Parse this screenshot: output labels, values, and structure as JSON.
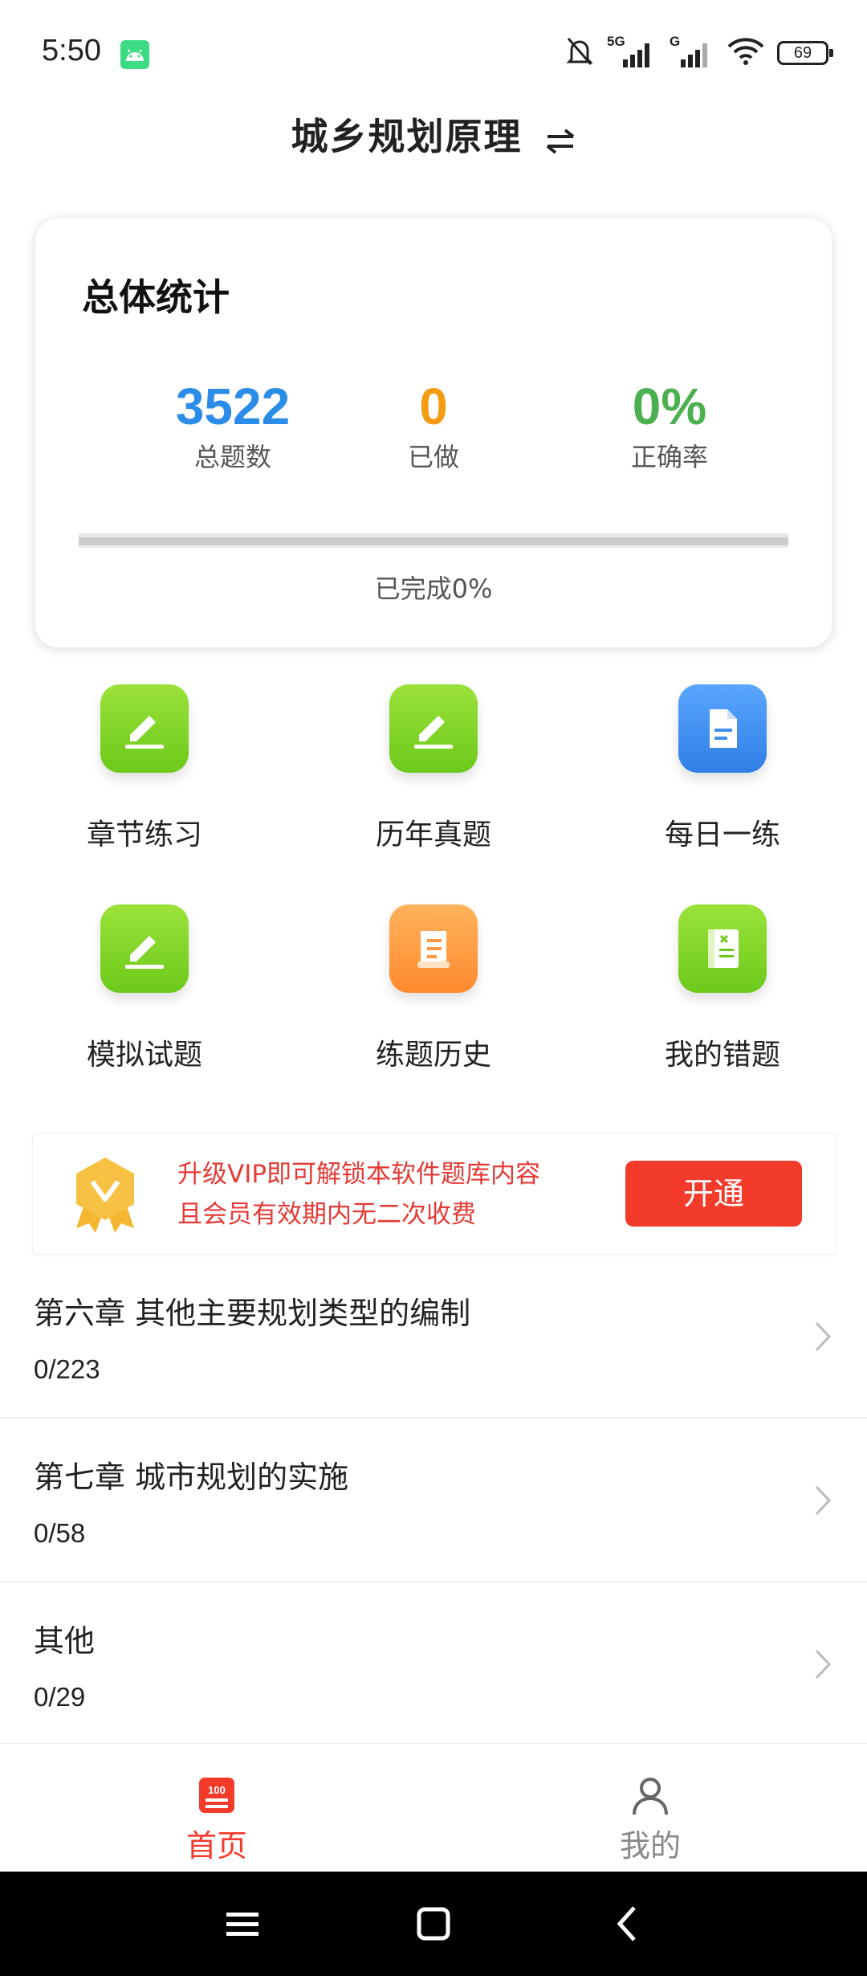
{
  "status_bar": {
    "time": "5:50",
    "network_1": "5G",
    "network_2": "G",
    "battery": "69"
  },
  "header": {
    "title": "城乡规划原理",
    "swap_icon": "swap-arrows-icon"
  },
  "stats": {
    "title": "总体统计",
    "total": {
      "value": "3522",
      "label": "总题数",
      "color": "#2b8de8"
    },
    "done": {
      "value": "0",
      "label": "已做",
      "color": "#f39c12"
    },
    "accuracy": {
      "value": "0%",
      "label": "正确率",
      "color": "#4caf50"
    },
    "progress_fraction": 0,
    "progress_text": "已完成0%"
  },
  "menu": [
    {
      "label": "章节练习",
      "icon": "pencil-icon",
      "color": "#7ed321"
    },
    {
      "label": "历年真题",
      "icon": "pencil-icon",
      "color": "#7ed321"
    },
    {
      "label": "每日一练",
      "icon": "document-icon",
      "color": "#3f8ef0"
    },
    {
      "label": "模拟试题",
      "icon": "pencil-icon",
      "color": "#7ed321"
    },
    {
      "label": "练题历史",
      "icon": "scroll-icon",
      "color": "#ff9640"
    },
    {
      "label": "我的错题",
      "icon": "notebook-x-icon",
      "color": "#7ed321"
    }
  ],
  "vip": {
    "line1": "升级VIP即可解锁本软件题库内容",
    "line2": "且会员有效期内无二次收费",
    "button": "开通",
    "badge_icon": "vip-badge-icon"
  },
  "chapters": [
    {
      "title": "第六章 其他主要规划类型的编制",
      "count": "0/223"
    },
    {
      "title": "第七章 城市规划的实施",
      "count": "0/58"
    },
    {
      "title": "其他",
      "count": "0/29"
    }
  ],
  "tabs": [
    {
      "label": "首页",
      "icon": "home-100-icon",
      "active": true,
      "color": "#f33b2c"
    },
    {
      "label": "我的",
      "icon": "person-icon",
      "active": false,
      "color": "#888888"
    }
  ]
}
